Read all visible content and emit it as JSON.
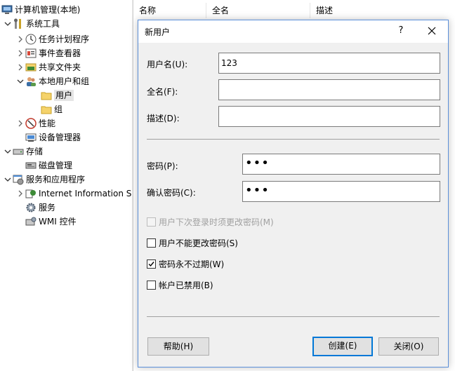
{
  "tree": {
    "root": "计算机管理(本地)",
    "items": [
      {
        "label": "系统工具",
        "icon": "tools-icon",
        "arrow": "expanded"
      },
      {
        "label": "任务计划程序",
        "icon": "clock-icon",
        "arrow": "collapsed"
      },
      {
        "label": "事件查看器",
        "icon": "event-viewer-icon",
        "arrow": "collapsed"
      },
      {
        "label": "共享文件夹",
        "icon": "shared-folder-icon",
        "arrow": "collapsed"
      },
      {
        "label": "本地用户和组",
        "icon": "users-icon",
        "arrow": "expanded"
      },
      {
        "label": "用户",
        "icon": "folder-icon",
        "arrow": "none"
      },
      {
        "label": "组",
        "icon": "folder-icon",
        "arrow": "none"
      },
      {
        "label": "性能",
        "icon": "performance-icon",
        "arrow": "collapsed"
      },
      {
        "label": "设备管理器",
        "icon": "device-manager-icon",
        "arrow": "none"
      },
      {
        "label": "存储",
        "icon": "storage-icon",
        "arrow": "expanded"
      },
      {
        "label": "磁盘管理",
        "icon": "disk-icon",
        "arrow": "none"
      },
      {
        "label": "服务和应用程序",
        "icon": "services-apps-icon",
        "arrow": "expanded"
      },
      {
        "label": "Internet Information S",
        "icon": "iis-icon",
        "arrow": "collapsed"
      },
      {
        "label": "服务",
        "icon": "gear-icon",
        "arrow": "none"
      },
      {
        "label": "WMI 控件",
        "icon": "wmi-icon",
        "arrow": "none"
      }
    ]
  },
  "list": {
    "columns": [
      "名称",
      "全名",
      "描述"
    ]
  },
  "dialog": {
    "title": "新用户",
    "help": "?",
    "username_label": "用户名(U):",
    "username_value": "123",
    "fullname_label": "全名(F):",
    "fullname_value": "",
    "description_label": "描述(D):",
    "description_value": "",
    "password_label": "密码(P):",
    "password_value": "•••",
    "confirm_label": "确认密码(C):",
    "confirm_value": "•••",
    "checkboxes": [
      {
        "label": "用户下次登录时须更改密码(M)",
        "checked": false,
        "enabled": false
      },
      {
        "label": "用户不能更改密码(S)",
        "checked": false,
        "enabled": true
      },
      {
        "label": "密码永不过期(W)",
        "checked": true,
        "enabled": true
      },
      {
        "label": "帐户已禁用(B)",
        "checked": false,
        "enabled": true
      }
    ],
    "buttons": {
      "help": "帮助(H)",
      "create": "创建(E)",
      "close": "关闭(O)"
    }
  },
  "colors": {
    "accent": "#0078d7",
    "dialog_border": "#5b8fd9",
    "folder": "#f5d36b"
  }
}
